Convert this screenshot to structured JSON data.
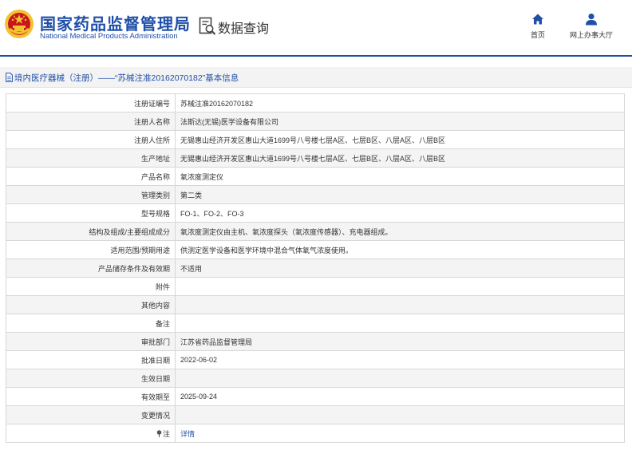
{
  "header": {
    "brand_cn": "国家药品监督管理局",
    "brand_en": "National Medical Products Administration",
    "query_title": "数据查询",
    "nav": [
      {
        "label": "首页",
        "icon": "home-icon"
      },
      {
        "label": "网上办事大厅",
        "icon": "user-icon"
      }
    ]
  },
  "breadcrumb": {
    "text": "境内医疗器械（注册）——“苏械注准20162070182”基本信息",
    "icon": "document-icon"
  },
  "colors": {
    "brand_blue": "#1f4fa8",
    "emblem_red": "#c8161d",
    "emblem_gold": "#f2c230"
  },
  "rows": [
    {
      "label": "注册证编号",
      "value": "苏械注准20162070182"
    },
    {
      "label": "注册人名称",
      "value": "法斯达(无锡)医学设备有限公司"
    },
    {
      "label": "注册人住所",
      "value": "无锡惠山经济开发区惠山大道1699号八号楼七层A区、七层B区、八层A区、八层B区"
    },
    {
      "label": "生产地址",
      "value": "无锡惠山经济开发区惠山大道1699号八号楼七层A区、七层B区、八层A区、八层B区"
    },
    {
      "label": "产品名称",
      "value": "氧浓度测定仪"
    },
    {
      "label": "管理类别",
      "value": "第二类"
    },
    {
      "label": "型号规格",
      "value": "FO-1、FO-2、FO-3"
    },
    {
      "label": "结构及组成/主要组成成分",
      "value": "氧浓度测定仪由主机、氧浓度探头（氧浓度传感器）、充电器组成。"
    },
    {
      "label": "适用范围/预期用途",
      "value": "供测定医学设备和医学环境中混合气体氧气浓度使用。"
    },
    {
      "label": "产品储存条件及有效期",
      "value": "不适用"
    },
    {
      "label": "附件",
      "value": ""
    },
    {
      "label": "其他内容",
      "value": ""
    },
    {
      "label": "备注",
      "value": ""
    },
    {
      "label": "审批部门",
      "value": "江苏省药品监督管理局"
    },
    {
      "label": "批准日期",
      "value": "2022-06-02"
    },
    {
      "label": "生效日期",
      "value": ""
    },
    {
      "label": "有效期至",
      "value": "2025-09-24"
    },
    {
      "label": "变更情况",
      "value": ""
    }
  ],
  "note_row": {
    "label": "注",
    "value": "详情",
    "icon": "pin-icon"
  }
}
